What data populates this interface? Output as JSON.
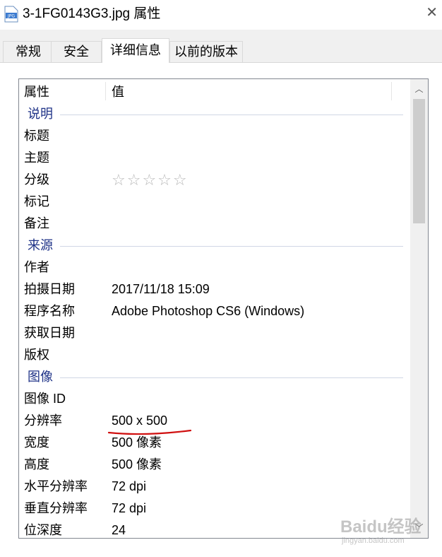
{
  "window": {
    "title": "3-1FG0143G3.jpg 属性",
    "file_icon_text": "JPG"
  },
  "tabs": [
    {
      "label": "常规"
    },
    {
      "label": "安全"
    },
    {
      "label": "详细信息"
    },
    {
      "label": "以前的版本"
    }
  ],
  "active_tab": "详细信息",
  "columns": {
    "property": "属性",
    "value": "值"
  },
  "groups": {
    "description": "说明",
    "origin": "来源",
    "image": "图像"
  },
  "rows": {
    "title": {
      "label": "标题",
      "value": ""
    },
    "subject": {
      "label": "主题",
      "value": ""
    },
    "rating": {
      "label": "分级",
      "value": "☆☆☆☆☆"
    },
    "tags": {
      "label": "标记",
      "value": ""
    },
    "comments": {
      "label": "备注",
      "value": ""
    },
    "author": {
      "label": "作者",
      "value": ""
    },
    "date_taken": {
      "label": "拍摄日期",
      "value": "2017/11/18 15:09"
    },
    "program": {
      "label": "程序名称",
      "value": "Adobe Photoshop CS6 (Windows)"
    },
    "date_acquired": {
      "label": "获取日期",
      "value": ""
    },
    "copyright": {
      "label": "版权",
      "value": ""
    },
    "image_id": {
      "label": "图像 ID",
      "value": ""
    },
    "dimensions": {
      "label": "分辨率",
      "value": "500 x 500"
    },
    "width": {
      "label": "宽度",
      "value": "500 像素"
    },
    "height": {
      "label": "高度",
      "value": "500 像素"
    },
    "h_res": {
      "label": "水平分辨率",
      "value": "72 dpi"
    },
    "v_res": {
      "label": "垂直分辨率",
      "value": "72 dpi"
    },
    "bit_depth": {
      "label": "位深度",
      "value": "24"
    }
  },
  "watermark": {
    "brand": "Baidu经验",
    "url": "jingyan.baidu.com"
  },
  "colors": {
    "group_header": "#1e3287",
    "annotation": "#d01010"
  }
}
